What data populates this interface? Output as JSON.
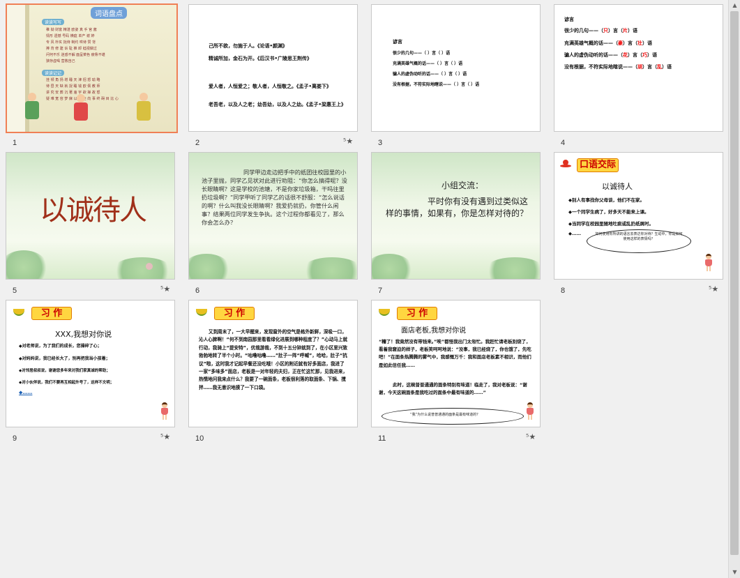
{
  "slides": [
    {
      "num": "1",
      "review": {
        "title": "词语盘点",
        "sec1": "读读写写",
        "sec2": "读读记记",
        "rows1": [
          "稚  拗    财富    精湛    欧姿    真  手    官  酱",
          "情形    遗憾    号码    横庭    单产    谢  婷",
          "专  风    朴实    批待    制约    哄待    赞  背",
          "捧  背    修  建    诉  耻    推  卸    蛙视做过",
          "问何不乐  迷惑不解  面呈菜色  疲惫不堪",
          "狭存虚喝  营救自己"
        ],
        "rows2": [
          "挂  倾    角  扬    增  睡    天  津    招  怒    瑜  略",
          "待  昼    天  缺    就  捉    睡  钱    欧  佩    教  师",
          "讲  究    安  葬    沉  著    庙  宇    欲  掸    故  怒",
          "疑  难    宽  容    梦  寐  以  求    走  向  事  终    碍  目  比  心"
        ]
      }
    },
    {
      "num": "2",
      "lines": [
        "己所不欲，勿施于人。《论语•颜渊》",
        "精诚所加，金石为开。《后汉书•广陵思王荆传》",
        "爱人者，人恒爱之；敬人者，人恒敬之。《孟子•离娄下》",
        "老吾老，以及人之老；幼吾幼，以及人之幼。《孟子•梁惠王上》"
      ]
    },
    {
      "num": "3",
      "title": "谚言",
      "lines": [
        "很少的几句——（    ）言（    ）语",
        "充满英雄气概的话——（    ）言（    ）语",
        "骗人的虚伪动听的话——（    ）言（    ）语",
        "没有根据，不符实际地瞎说——（    ）言（    ）语"
      ]
    },
    {
      "num": "4",
      "title": "谚言",
      "items": [
        {
          "pre": "很少的几句——（",
          "a": "只",
          "mid": "）言（",
          "b": "片",
          "post": "）语"
        },
        {
          "pre": "充满英雄气概的话——（",
          "a": "豪",
          "mid": "）言（",
          "b": "壮",
          "post": "）语"
        },
        {
          "pre": "骗人的虚伪动听的话——（",
          "a": "花",
          "mid": "）言（",
          "b": "巧",
          "post": "）语"
        },
        {
          "pre": "没有根据，不符实际地瞎说——（",
          "a": "胡",
          "mid": "）言（",
          "b": "乱",
          "post": "）语"
        }
      ]
    },
    {
      "num": "5",
      "title": "以诚待人"
    },
    {
      "num": "6",
      "body": "同学甲边走边把手中的纸团往校园里的小池子里抛，同学乙见状对此进行劝阻：“你怎么搞得呢？没长眼睛啊？这是学校的池塘，不是你家垃圾箱，干吗往里扔垃圾啊？”同学甲听了同学乙的话很不舒服：“怎么说话的啊？什么叫我没长眼睛啊？我爱扔就扔，你管什么闲事？结果两位同学发生争执。这个过程你都看见了，那么你会怎么办？"
    },
    {
      "num": "7",
      "title": "小组交流：",
      "body": "平时你有没有遇到过类似这样的事情，如果有，你是怎样对待的？"
    },
    {
      "num": "8",
      "tag": "口语交际",
      "title": "以诚待人",
      "items": [
        "◆别人有事找你父母谈，他们不在家。",
        "◆一个同学生病了，好多天不能来上课。",
        "◆当同学在校园里随地吐痰或乱扔纸屑时。",
        "◆……"
      ],
      "bubble": "如何使用你所讲的语言去表达你对待？生动中，你是如何使用这样的表情吗？"
    },
    {
      "num": "9",
      "tag": "习 作",
      "title": "XXX,我想对你说",
      "items": [
        "◆对老师说，为了我们的成长，您操碎了心；",
        "◆对妈妈说，我已经长大了，别再把我当小孩着；",
        "◆对邻居叔叔说，谢谢您多年来对我们家真诚的帮助；",
        "◆对小伙伴说，我们不要再互相起外号了，这样不文明；",
        "◆……"
      ]
    },
    {
      "num": "10",
      "tag": "习 作",
      "body": "又到周末了，一大早醒来，发现窗外的空气是格外新鲜，深吸一口，沁人心脾啊！“何不到南园那里看看绿化进展到哪种程度了？”心动马上就行动，我骑上“提安特”，优哉游哉，不到十五分钟就到了，在小区里兴致勃勃地转了半个小时。“咕噜咕噜……”肚子一阵“呼喊”，哈哈，肚子“抗议”啦，这时我才记起早餐还没吃哦！小区的附近就有好多面店，我进了一家“多味多”面店，老板是一对年轻的夫妇，正在忙这忙那，见我进来，热情地问我来点什么？我要了一碗面条，老板很利落的取面条、下锅、搅拌……我无意识地摸了一下口袋。"
    },
    {
      "num": "11",
      "tag": "习 作",
      "title": "面店老板,我想对你说",
      "body1": "“糟了！我竟然没有带钱来。”唉”都怪我出门太匆忙。我赶忙请老板别烧了，看着我窘迫的样子，老板笑呵呵地说：“没事，我已经烧了，你也饿了，先吃吧！”在面条热腾腾的雾气中，我感慨万千：我和面店老板素不相识，而他们是如此信任我……",
      "body2": "此时，这碗普普通通的面条特别有味道！临走了，我对老板说：“谢谢，今天这碗面条是我吃过的面条中最有味道的……”",
      "bubble": "“我”为什么说普普通通的面条是最有味道的？"
    }
  ],
  "colors": {
    "selected_border": "#f07f55",
    "red": "#e00000",
    "title_brown": "#a0301a",
    "tag_yellow": "#ffd640"
  }
}
